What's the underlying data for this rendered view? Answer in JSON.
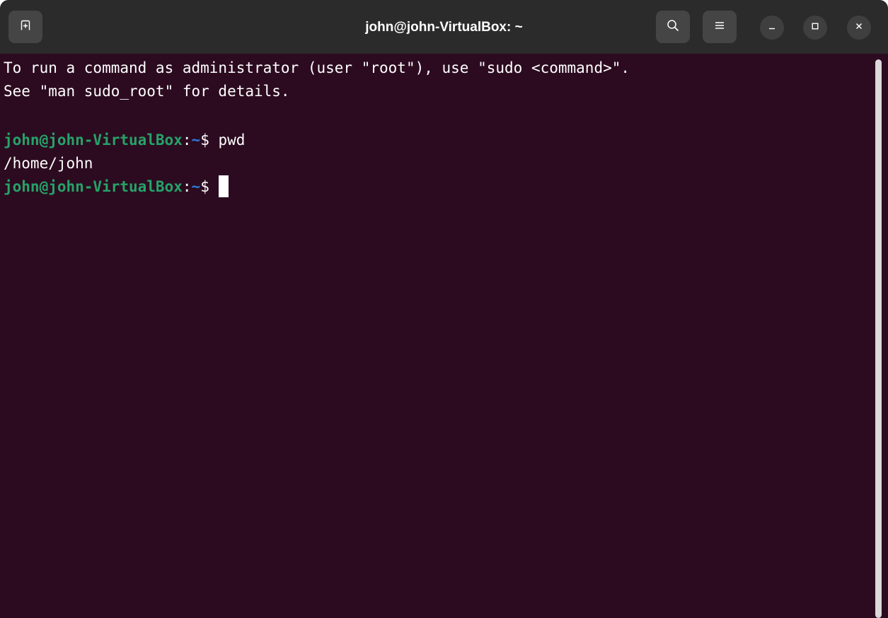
{
  "window": {
    "title": "john@john-VirtualBox: ~"
  },
  "titlebar": {
    "buttons": {
      "new_tab_icon": "new-tab-icon",
      "search_icon": "search-icon",
      "menu_icon": "hamburger-menu-icon",
      "minimize_icon": "minimize-icon",
      "maximize_icon": "maximize-icon",
      "close_icon": "close-icon"
    }
  },
  "terminal": {
    "lines": [
      "To run a command as administrator (user \"root\"), use \"sudo <command>\".",
      "See \"man sudo_root\" for details."
    ],
    "session": [
      {
        "user_host": "john@john-VirtualBox",
        "colon": ":",
        "path": "~",
        "symbol": "$ ",
        "command": "pwd",
        "output": "/home/john"
      },
      {
        "user_host": "john@john-VirtualBox",
        "colon": ":",
        "path": "~",
        "symbol": "$ ",
        "command": ""
      }
    ]
  },
  "colors": {
    "background": "#2c0b20",
    "titlebar": "#2b2b2b",
    "prompt_user": "#26a269",
    "prompt_path": "#2a7bde",
    "text": "#ffffff"
  }
}
